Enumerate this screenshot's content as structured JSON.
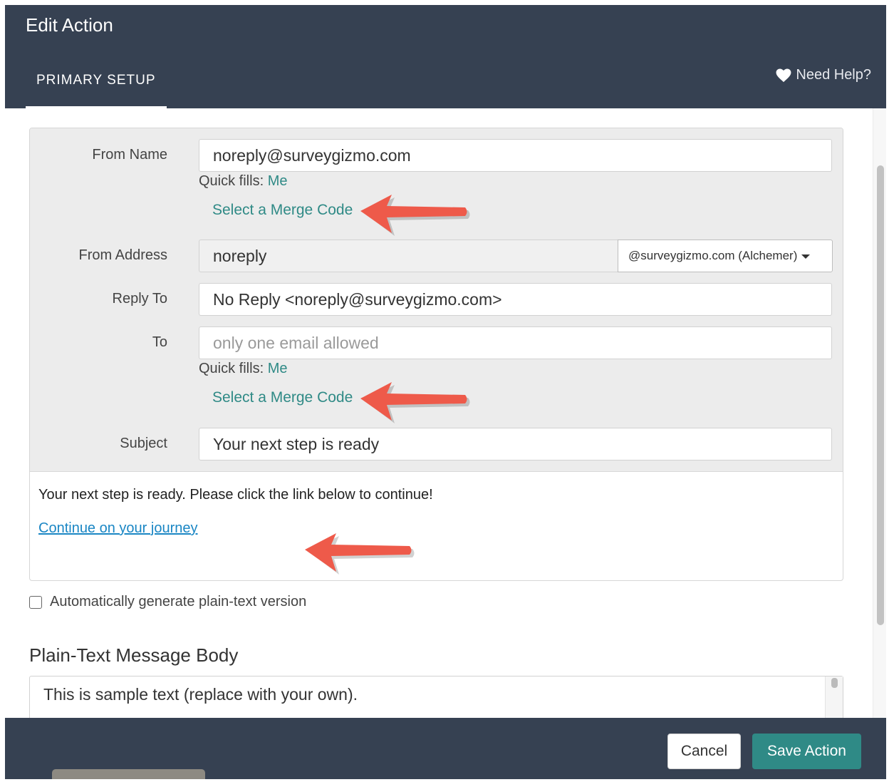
{
  "header": {
    "title": "Edit Action",
    "tab_label": "PRIMARY SETUP",
    "help_label": "Need Help?",
    "help_icon": "heart-icon"
  },
  "form": {
    "from_name": {
      "label": "From Name",
      "value": "noreply@surveygizmo.com",
      "quick_fills_label": "Quick fills:",
      "quick_fills_me": "Me",
      "merge_code": "Select a Merge Code"
    },
    "from_address": {
      "label": "From Address",
      "value": "noreply",
      "domain_selected": "@surveygizmo.com (Alchemer)"
    },
    "reply_to": {
      "label": "Reply To",
      "value": "No Reply <noreply@surveygizmo.com>"
    },
    "to": {
      "label": "To",
      "placeholder": "only one email allowed",
      "quick_fills_label": "Quick fills:",
      "quick_fills_me": "Me",
      "merge_code": "Select a Merge Code"
    },
    "subject": {
      "label": "Subject",
      "value": "Your next step is ready"
    }
  },
  "message": {
    "body_text": "Your next step is ready. Please click the link below to continue!",
    "link_text": "Continue on your journey"
  },
  "plain_text": {
    "checkbox_label": "Automatically generate plain-text version",
    "checkbox_checked": false,
    "section_title": "Plain-Text Message Body",
    "body": "This is sample text (replace with your own)."
  },
  "footer": {
    "cancel_label": "Cancel",
    "save_label": "Save Action"
  },
  "colors": {
    "header_bg": "#364152",
    "accent_teal": "#2f8a86",
    "link_blue": "#1a86c4",
    "annotation_arrow": "#ee5a4a"
  }
}
